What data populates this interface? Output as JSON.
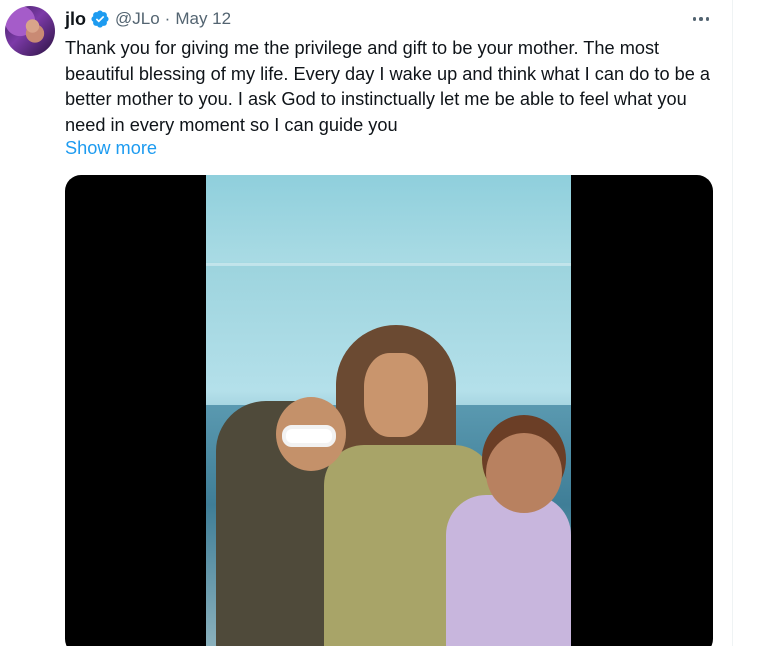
{
  "tweet": {
    "author": {
      "display_name": "jlo",
      "handle": "@JLo",
      "verified": true,
      "verified_color": "#1d9bf0"
    },
    "separator": "·",
    "date": "May 12",
    "text": "Thank you for giving me the privilege and gift to be your mother. The most beautiful blessing of my life. Every day I wake up and think what I can do to be a better mother to you. I ask God to instinctually let me be able to feel what you need in every moment so I can guide you",
    "show_more_label": "Show more",
    "link_color": "#1d9bf0",
    "icons": {
      "more": "more-horizontal-icon",
      "verified": "verified-badge-icon"
    }
  }
}
